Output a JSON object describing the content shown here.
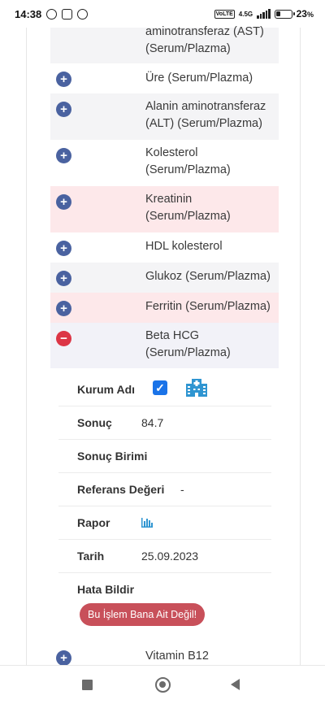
{
  "status_bar": {
    "time": "14:38",
    "battery_percent": "23",
    "battery_suffix": "%",
    "network": "4.5G"
  },
  "tests": [
    {
      "name": "aminotransferaz (AST) (Serum/Plazma)",
      "state": "collapsed"
    },
    {
      "name": "Üre (Serum/Plazma)",
      "state": "collapsed"
    },
    {
      "name": "Alanin aminotransferaz (ALT) (Serum/Plazma)",
      "state": "collapsed"
    },
    {
      "name": "Kolesterol (Serum/Plazma)",
      "state": "collapsed"
    },
    {
      "name": "Kreatinin (Serum/Plazma)",
      "state": "collapsed"
    },
    {
      "name": "HDL kolesterol",
      "state": "collapsed"
    },
    {
      "name": "Glukoz (Serum/Plazma)",
      "state": "collapsed"
    },
    {
      "name": "Ferritin (Serum/Plazma)",
      "state": "collapsed"
    },
    {
      "name": "Beta HCG (Serum/Plazma)",
      "state": "expanded"
    },
    {
      "name": "Vitamin B12",
      "state": "collapsed"
    }
  ],
  "toggle": {
    "plus": "+",
    "minus": "−"
  },
  "detail": {
    "institution_label": "Kurum Adı",
    "institution_checked": true,
    "result_label": "Sonuç",
    "result_value": "84.7",
    "unit_label": "Sonuç Birimi",
    "unit_value": "",
    "reference_label": "Referans Değeri",
    "reference_value": "-",
    "report_label": "Rapor",
    "date_label": "Tarih",
    "date_value": "25.09.2023",
    "error_label": "Hata Bildir",
    "error_button": "Bu İşlem Bana Ait Değil!"
  },
  "icons": {
    "hospital": "hospital-building-icon",
    "report": "bar-chart-icon",
    "checkbox": "checkmark-icon"
  },
  "colors": {
    "toggle_plus": "#4a62a0",
    "toggle_minus": "#dc3545",
    "highlight_row": "#fde8ea",
    "button": "#c8505a",
    "icon_blue": "#2f95d1"
  }
}
